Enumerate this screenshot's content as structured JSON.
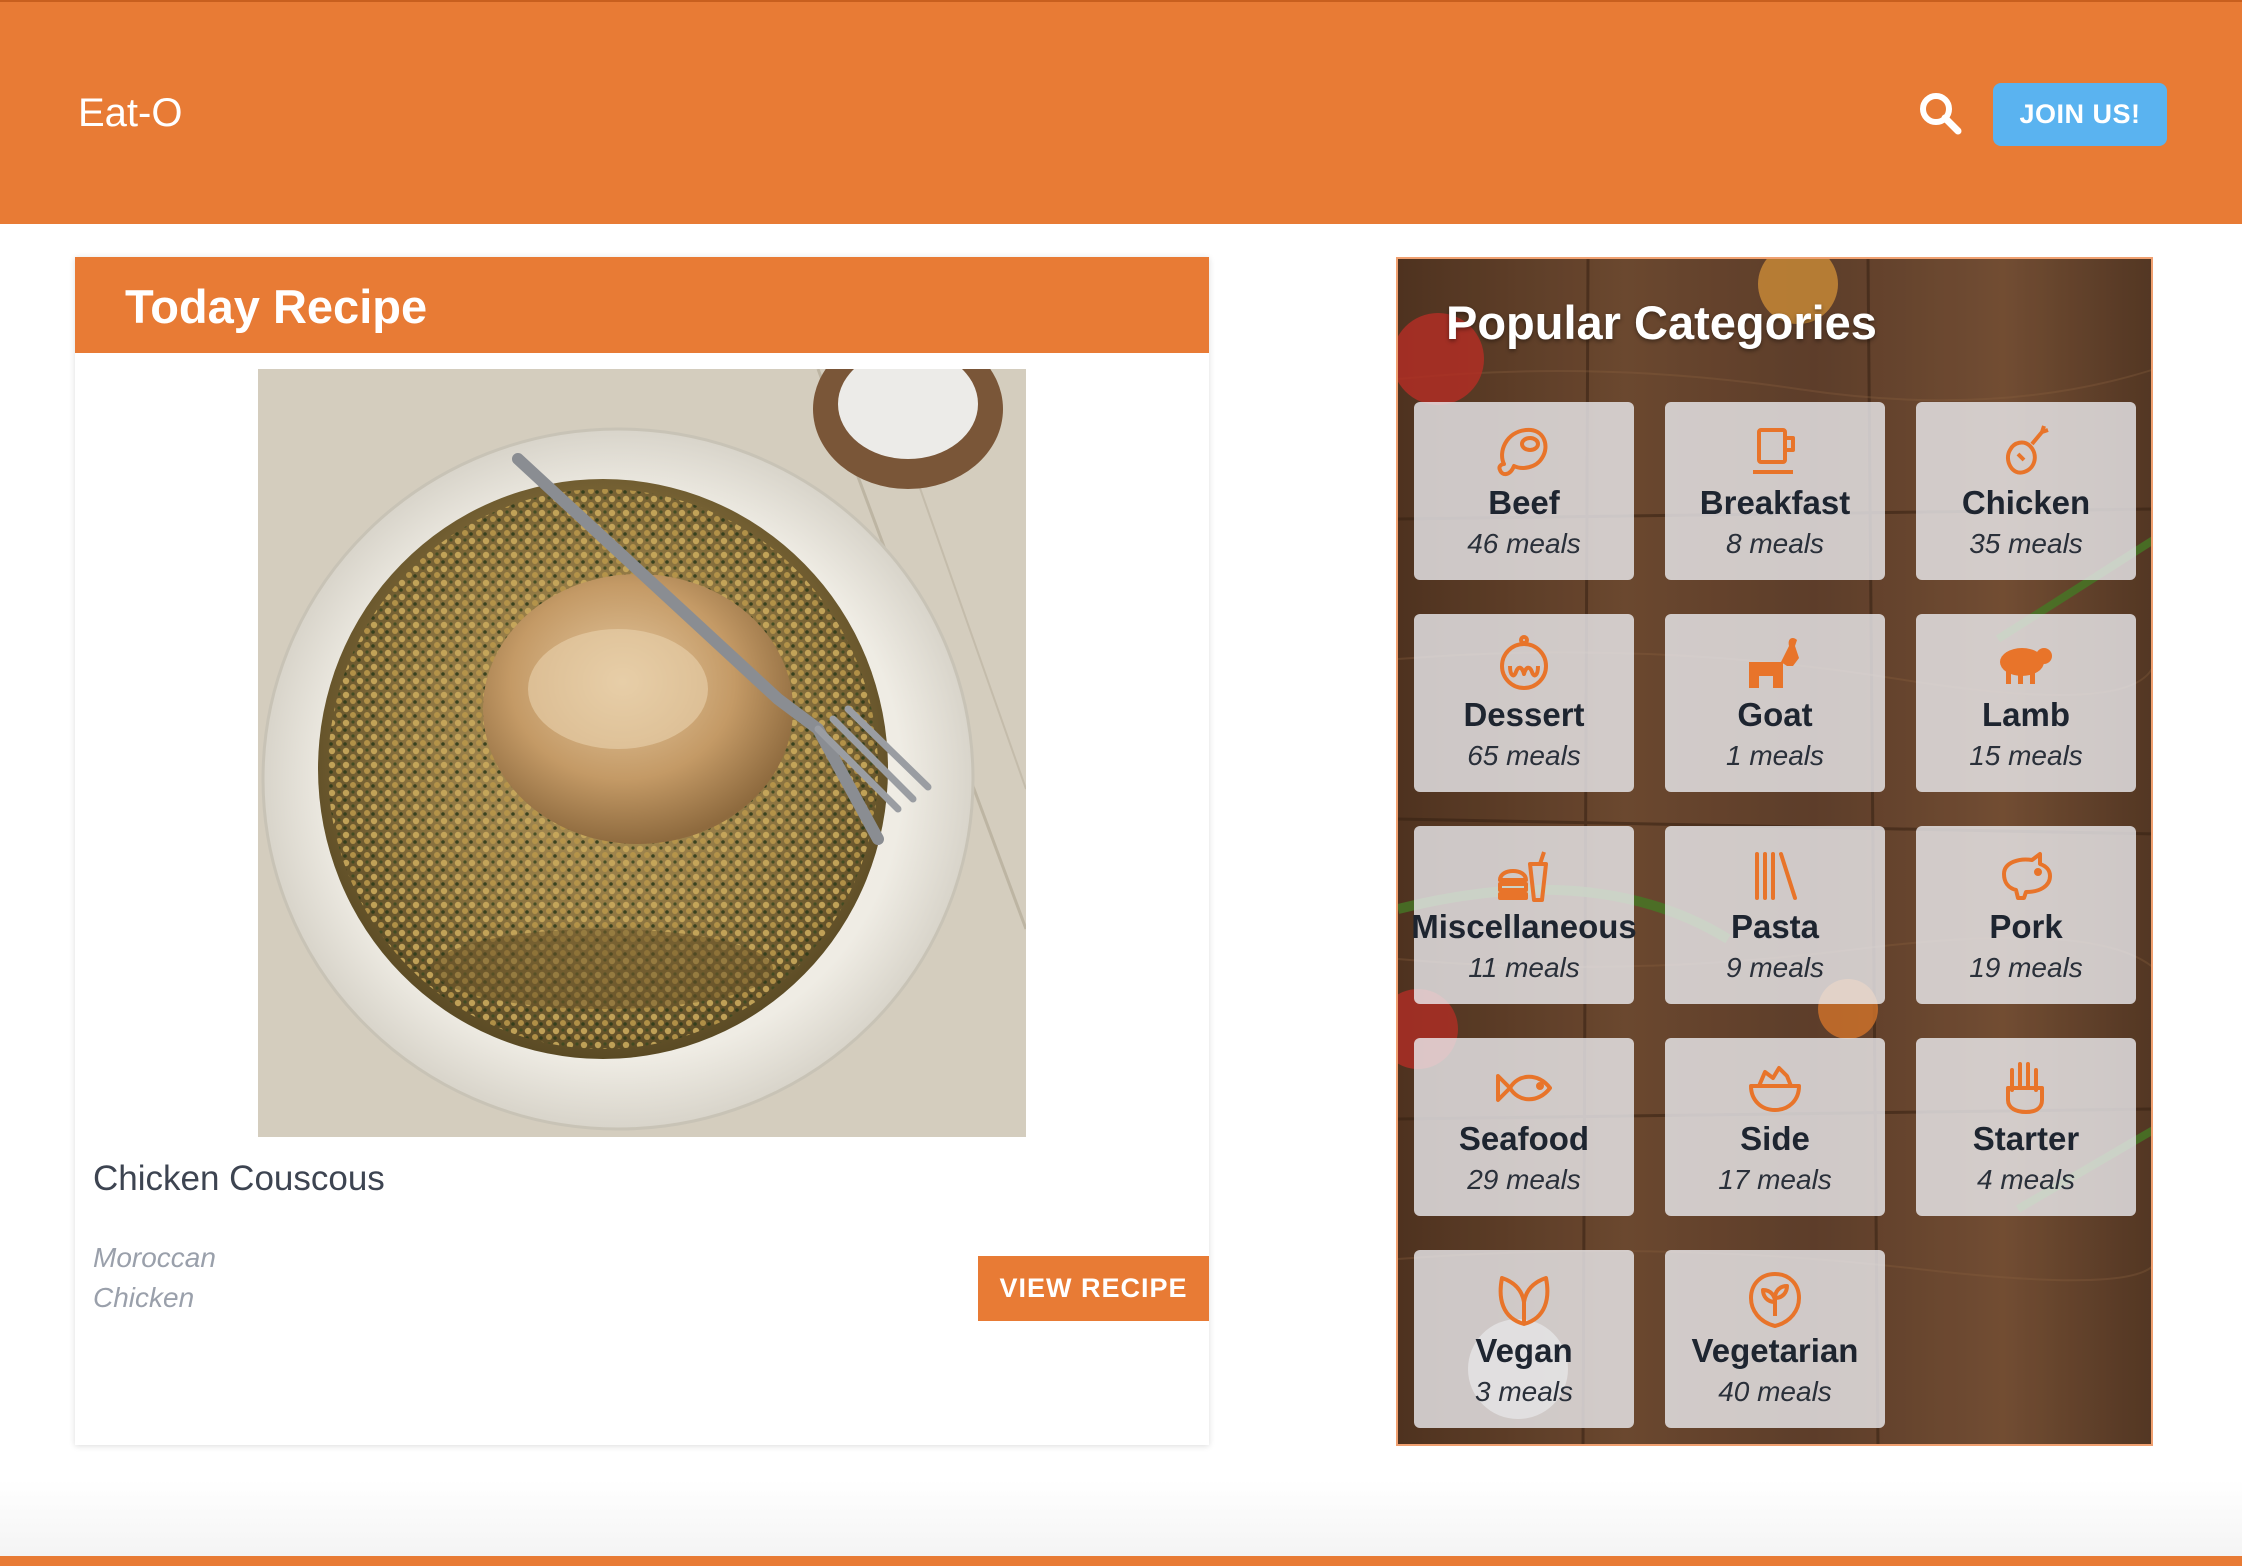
{
  "app": {
    "brand": "Eat-O"
  },
  "header": {
    "search_icon": "search-icon",
    "join_label": "JOIN US!"
  },
  "today": {
    "heading": "Today Recipe",
    "name": "Chicken Couscous",
    "area": "Moroccan",
    "category": "Chicken",
    "button_label": "VIEW RECIPE"
  },
  "categories": {
    "heading": "Popular Categories",
    "items": [
      {
        "name": "Beef",
        "count": "46 meals",
        "icon": "steak-icon"
      },
      {
        "name": "Breakfast",
        "count": "8 meals",
        "icon": "coffee-cup-icon"
      },
      {
        "name": "Chicken",
        "count": "35 meals",
        "icon": "chicken-leg-icon"
      },
      {
        "name": "Dessert",
        "count": "65 meals",
        "icon": "dessert-icon"
      },
      {
        "name": "Goat",
        "count": "1 meals",
        "icon": "goat-icon"
      },
      {
        "name": "Lamb",
        "count": "15 meals",
        "icon": "sheep-icon"
      },
      {
        "name": "Miscellaneous",
        "count": "11 meals",
        "icon": "fast-food-icon"
      },
      {
        "name": "Pasta",
        "count": "9 meals",
        "icon": "pasta-icon"
      },
      {
        "name": "Pork",
        "count": "19 meals",
        "icon": "pig-icon"
      },
      {
        "name": "Seafood",
        "count": "29 meals",
        "icon": "fish-icon"
      },
      {
        "name": "Side",
        "count": "17 meals",
        "icon": "bowl-icon"
      },
      {
        "name": "Starter",
        "count": "4 meals",
        "icon": "hand-icon"
      },
      {
        "name": "Vegan",
        "count": "3 meals",
        "icon": "vegan-leaf-icon"
      },
      {
        "name": "Vegetarian",
        "count": "40 meals",
        "icon": "vegetarian-sprout-icon"
      }
    ]
  },
  "colors": {
    "brand_orange": "#e87b35",
    "join_blue": "#5ab3f0",
    "icon_orange": "#e8742a"
  }
}
